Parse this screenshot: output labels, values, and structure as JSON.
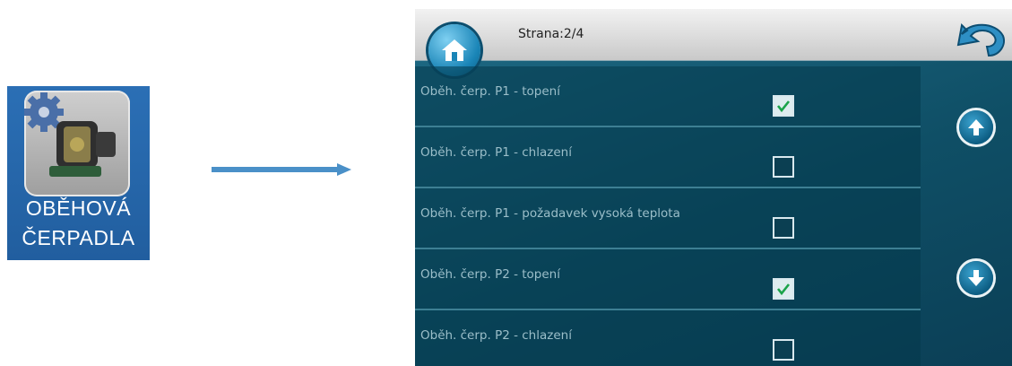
{
  "tile": {
    "label_line1": "OBĚHOVÁ",
    "label_line2": "ČERPADLA",
    "icon": "pump-gear-icon"
  },
  "panel": {
    "page_label": "Strana:2/4",
    "home_icon": "home-icon",
    "back_icon": "back-arrow-icon",
    "up_icon": "arrow-up-icon",
    "down_icon": "arrow-down-icon",
    "rows": [
      {
        "label": "Oběh. čerp. P1 - topení",
        "checked": true
      },
      {
        "label": "Oběh. čerp. P1 - chlazení",
        "checked": false
      },
      {
        "label": "Oběh. čerp. P1 - požadavek vysoká teplota",
        "checked": false
      },
      {
        "label": "Oběh. čerp. P2 - topení",
        "checked": true
      },
      {
        "label": "Oběh. čerp. P2 - chlazení",
        "checked": false
      }
    ]
  },
  "colors": {
    "tile_blue": "#2b6fb5",
    "panel_teal": "#0f4f66",
    "check_green": "#1aa34a",
    "arrow_blue": "#4a90c8"
  }
}
